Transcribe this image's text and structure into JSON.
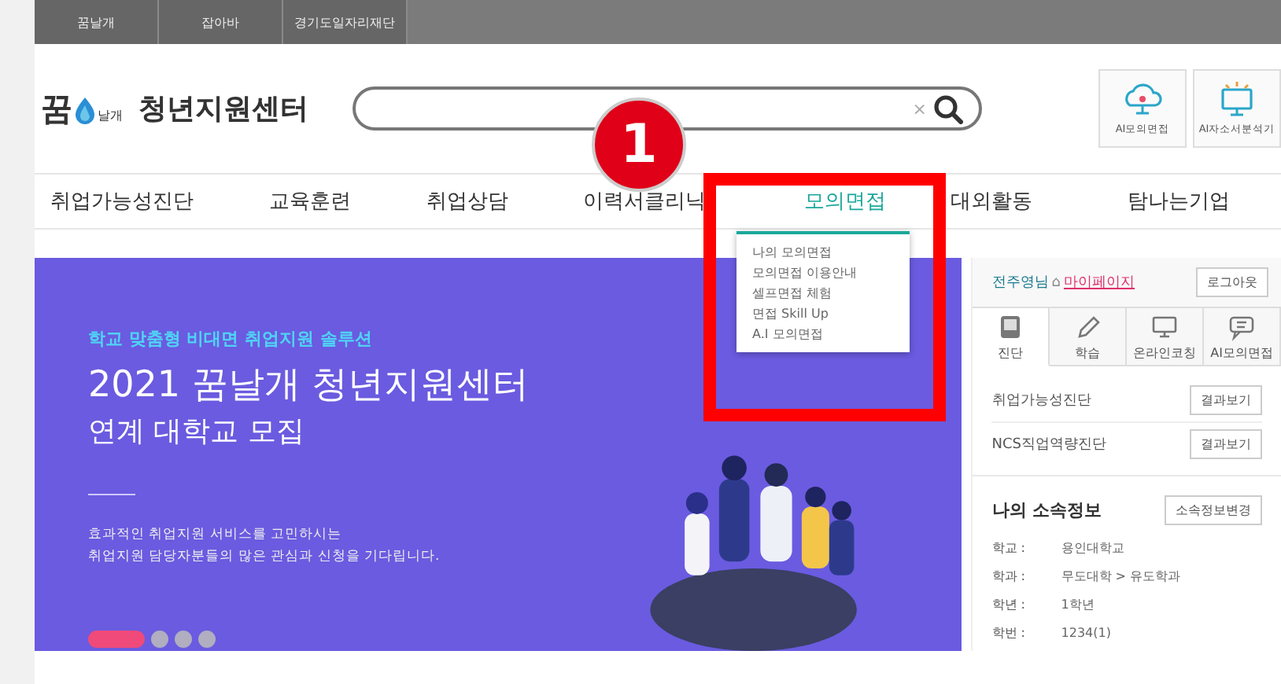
{
  "top_links": [
    {
      "label": "꿈날개"
    },
    {
      "label": "잡아바"
    },
    {
      "label": "경기도일자리재단"
    }
  ],
  "logo": {
    "mark_big": "꿈",
    "mark_small": "날개",
    "title": "청년지원센터"
  },
  "search": {
    "clear": "×"
  },
  "quick_buttons": [
    {
      "label": "AI모의면접",
      "kind": "cloud"
    },
    {
      "label": "AI자소서분석기",
      "kind": "monitor"
    }
  ],
  "nav": [
    {
      "label": "취업가능성진단",
      "selected": false
    },
    {
      "label": "교육훈련",
      "selected": false
    },
    {
      "label": "취업상담",
      "selected": false
    },
    {
      "label": "이력서클리닉",
      "selected": false
    },
    {
      "label": "모의면접",
      "selected": true
    },
    {
      "label": "대외활동",
      "selected": false
    },
    {
      "label": "탐나는기업",
      "selected": false
    }
  ],
  "dropdown": [
    "나의 모의면접",
    "모의면접 이용안내",
    "셀프면접 체험",
    "면접 Skill Up",
    "A.I 모의면접"
  ],
  "annotation": {
    "number": "1"
  },
  "banner": {
    "eyebrow": "학교 맞춤형 비대면 취업지원 솔루션",
    "title": "2021 꿈날개 청년지원센터",
    "subtitle": "연계 대학교 모집",
    "description": [
      "효과적인 취업지원 서비스를 고민하시는",
      "취업지원 담당자분들의 많은 관심과 신청을 기다립니다."
    ],
    "slides": [
      {
        "selected": true
      },
      {
        "selected": false
      },
      {
        "selected": false
      },
      {
        "selected": false
      }
    ]
  },
  "user_panel": {
    "greeting": "전주영님",
    "home": "⌂",
    "mypage_link": "마이페이지",
    "logout": "로그아웃",
    "tabs": [
      {
        "label": "진단",
        "kind": "tablet",
        "selected": true
      },
      {
        "label": "학습",
        "kind": "pencil",
        "selected": false
      },
      {
        "label": "온라인코칭",
        "kind": "monitor",
        "selected": false
      },
      {
        "label": "AI모의면접",
        "kind": "chat",
        "selected": false
      }
    ],
    "results": [
      {
        "label": "취업가능성진단",
        "button": "결과보기"
      },
      {
        "label": "NCS직업역량진단",
        "button": "결과보기"
      }
    ],
    "affiliation": {
      "title": "나의 소속정보",
      "button": "소속정보변경",
      "fields": [
        {
          "label": "학교 :",
          "value": "용인대학교"
        },
        {
          "label": "학과 :",
          "value": "무도대학 > 유도학과"
        },
        {
          "label": "학년 :",
          "value": "1학년"
        },
        {
          "label": "학번 :",
          "value": "1234(1)"
        }
      ]
    }
  }
}
